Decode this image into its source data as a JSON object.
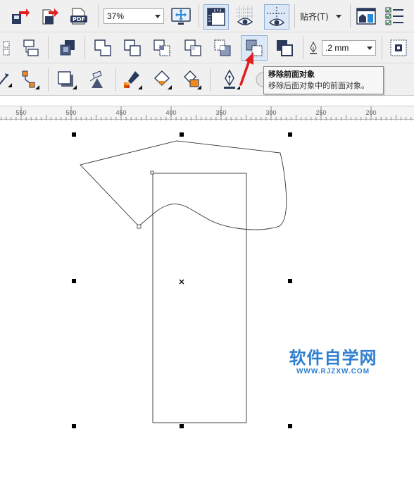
{
  "toolbar": {
    "zoom": {
      "value": "37%"
    },
    "snap": {
      "label": "贴齐(T)"
    },
    "outline_width": {
      "value": ".2 mm"
    }
  },
  "tooltip": {
    "title": "移除前面对象",
    "description": "移除后面对象中的前面对象。"
  },
  "ruler": {
    "labels": [
      "550",
      "500",
      "450",
      "400",
      "350",
      "300",
      "250",
      "200"
    ]
  },
  "watermark": {
    "main": "软件自学网",
    "sub": "WWW.RJZXW.COM",
    "color": "#2f7fd0"
  },
  "colors": {
    "accent_red": "#e02020",
    "icon_dark": "#2b3a5c",
    "orange": "#f08a1c"
  }
}
